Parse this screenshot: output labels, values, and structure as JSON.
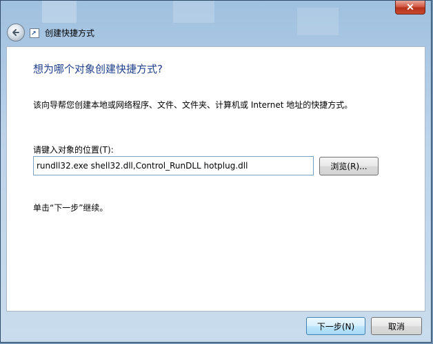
{
  "window": {
    "title": "创建快捷方式",
    "close_glyph": "✕"
  },
  "page": {
    "heading": "想为哪个对象创建快捷方式?",
    "description": "该向导帮您创建本地或网络程序、文件、文件夹、计算机或 Internet 地址的快捷方式。",
    "location_label": "请键入对象的位置(T):",
    "location_value": "rundll32.exe shell32.dll,Control_RunDLL hotplug.dll",
    "browse_label": "浏览(R)...",
    "hint": "单击“下一步”继续。"
  },
  "footer": {
    "next_label": "下一步(N)",
    "cancel_label": "取消"
  },
  "icons": {
    "back": "back-arrow-icon",
    "wizard": "shortcut-icon",
    "close": "close-icon"
  }
}
